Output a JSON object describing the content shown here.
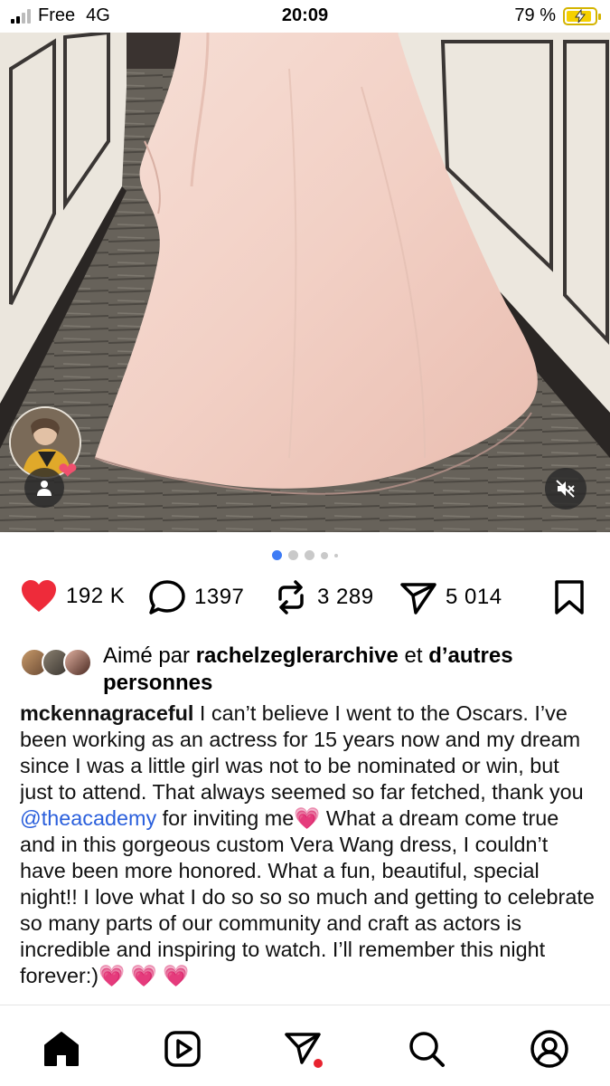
{
  "status": {
    "carrier": "Free",
    "network": "4G",
    "time": "20:09",
    "battery": "79 %",
    "battery_level": 0.79
  },
  "post": {
    "carousel_index": 1,
    "carousel_count": 5
  },
  "actions": {
    "likes": "192 K",
    "comments": "1397",
    "reposts": "3 289",
    "shares": "5 014"
  },
  "liked_by": {
    "prefix": "Aimé par",
    "user": "rachelzeglerarchive",
    "and": "et",
    "others": "d’autres personnes"
  },
  "caption": {
    "username": "mckennagraceful",
    "text_part1": "I can’t believe I went to the Oscars. I’ve been working as an actress for 15 years now and my dream since I was a little girl was not to be nominated or win, but just to attend. That always seemed so far fetched, thank you",
    "mention": "@theacademy",
    "text_part2": "for inviting me💗 What a dream come true and in this gorgeous custom Vera Wang dress, I couldn’t have been more honored. What a fun, beautiful, special night!! I love what I do so so so much and getting to celebrate so many parts of our community and craft as actors is incredible and inspiring to watch. I’ll remember this night forever:)💗 💗 💗"
  },
  "nav": [
    "home",
    "reels",
    "direct",
    "search",
    "profile"
  ]
}
